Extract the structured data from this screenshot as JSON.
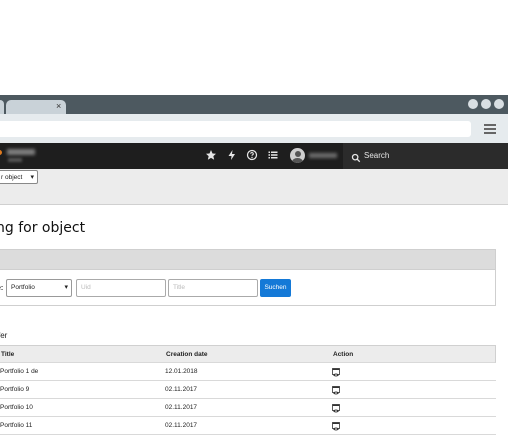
{
  "browser": {
    "tab_close": "×"
  },
  "header": {
    "search_label": "Search",
    "icons": [
      "star-icon",
      "lightning-icon",
      "help-icon",
      "list-icon",
      "avatar-icon",
      "search-icon"
    ]
  },
  "context": {
    "select_value": "r object"
  },
  "page": {
    "title": "ng for object"
  },
  "filter": {
    "label": "e:",
    "type_value": "Portfolio",
    "uid_placeholder": "Uid",
    "title_placeholder": "Title",
    "submit_label": "Suchen"
  },
  "results": {
    "heading": "fer",
    "columns": [
      "Title",
      "Creation date",
      "Action"
    ],
    "rows": [
      {
        "title": "Portfolio 1 de",
        "date": "12.01.2018"
      },
      {
        "title": "Portfolio 9",
        "date": "02.11.2017"
      },
      {
        "title": "Portfolio 10",
        "date": "02.11.2017"
      },
      {
        "title": "Portfolio 11",
        "date": "02.11.2017"
      }
    ]
  },
  "colors": {
    "header_bg": "#1e1e1e",
    "tabbar_bg": "#4d5960",
    "accent": "#1479d7"
  }
}
